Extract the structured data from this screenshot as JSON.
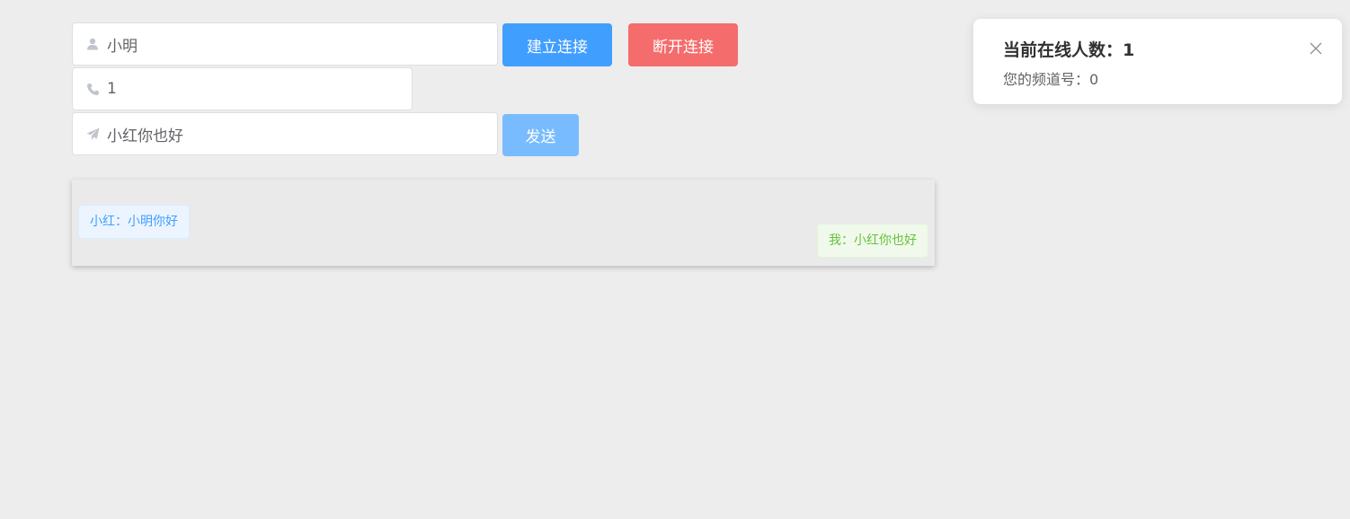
{
  "form": {
    "name": {
      "value": "小明",
      "icon": "user-icon"
    },
    "channel": {
      "value": "1",
      "icon": "phone-icon"
    },
    "message": {
      "value": "小红你也好",
      "icon": "send-icon"
    }
  },
  "buttons": {
    "connect_label": "建立连接",
    "disconnect_label": "断开连接",
    "send_label": "发送"
  },
  "chat": {
    "messages": [
      {
        "side": "left",
        "text": "小红：小明你好"
      },
      {
        "side": "right",
        "text": "我：小红你也好"
      }
    ]
  },
  "notification": {
    "title": "当前在线人数：1",
    "text": "您的频道号：0",
    "close_icon": "close-icon"
  },
  "colors": {
    "primary": "#409eff",
    "danger": "#f56c6c",
    "primary_light": "#79bbff",
    "success": "#67c23a",
    "background": "#ededed"
  }
}
